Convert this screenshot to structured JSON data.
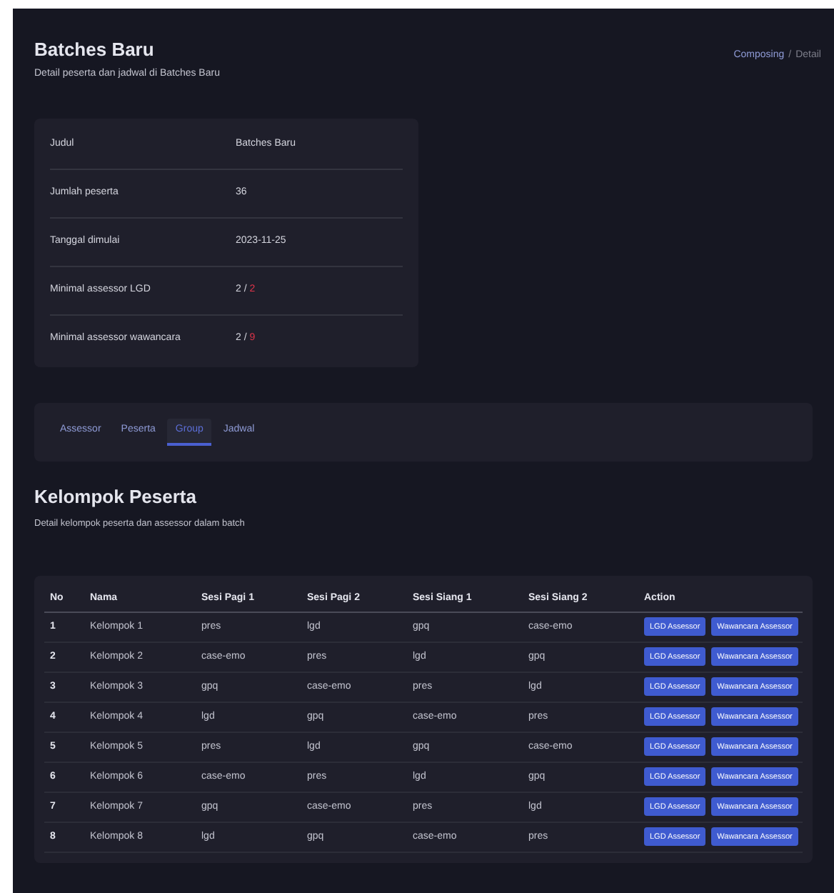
{
  "header": {
    "title": "Batches Baru",
    "subtitle": "Detail peserta dan jadwal di Batches Baru"
  },
  "breadcrumb": [
    {
      "label": "Composing",
      "link": true
    },
    {
      "label": "/",
      "link": false
    },
    {
      "label": "Detail",
      "link": false
    }
  ],
  "details": [
    {
      "kind": "text",
      "label": "Judul",
      "value": "Batches Baru"
    },
    {
      "kind": "text",
      "label": "Jumlah peserta",
      "value": "36"
    },
    {
      "kind": "text",
      "label": "Tanggal dimulai",
      "value": "2023-11-25"
    },
    {
      "kind": "ratio",
      "label": "Minimal assessor LGD",
      "value": "2",
      "separator": "/",
      "limit": "2"
    },
    {
      "kind": "ratio",
      "label": "Minimal assessor wawancara",
      "value": "2",
      "separator": "/",
      "limit": "9"
    }
  ],
  "tabs": [
    {
      "label": "Assessor",
      "selected": false
    },
    {
      "label": "Peserta",
      "selected": false
    },
    {
      "label": "Group",
      "selected": true
    },
    {
      "label": "Jadwal",
      "selected": false
    }
  ],
  "section": {
    "title": "Kelompok Peserta",
    "subtitle": "Detail kelompok peserta dan assessor dalam batch"
  },
  "table": {
    "columns": [
      "No",
      "Nama",
      "Sesi Pagi 1",
      "Sesi Pagi 2",
      "Sesi Siang 1",
      "Sesi Siang 2",
      "Action"
    ],
    "rows": [
      {
        "cells": [
          "1",
          "Kelompok 1",
          "pres",
          "lgd",
          "gpq",
          "case-emo"
        ],
        "actions": [
          "LGD Assessor",
          "Wawancara Assessor"
        ]
      },
      {
        "cells": [
          "2",
          "Kelompok 2",
          "case-emo",
          "pres",
          "lgd",
          "gpq"
        ],
        "actions": [
          "LGD Assessor",
          "Wawancara Assessor"
        ]
      },
      {
        "cells": [
          "3",
          "Kelompok 3",
          "gpq",
          "case-emo",
          "pres",
          "lgd"
        ],
        "actions": [
          "LGD Assessor",
          "Wawancara Assessor"
        ]
      },
      {
        "cells": [
          "4",
          "Kelompok 4",
          "lgd",
          "gpq",
          "case-emo",
          "pres"
        ],
        "actions": [
          "LGD Assessor",
          "Wawancara Assessor"
        ]
      },
      {
        "cells": [
          "5",
          "Kelompok 5",
          "pres",
          "lgd",
          "gpq",
          "case-emo"
        ],
        "actions": [
          "LGD Assessor",
          "Wawancara Assessor"
        ]
      },
      {
        "cells": [
          "6",
          "Kelompok 6",
          "case-emo",
          "pres",
          "lgd",
          "gpq"
        ],
        "actions": [
          "LGD Assessor",
          "Wawancara Assessor"
        ]
      },
      {
        "cells": [
          "7",
          "Kelompok 7",
          "gpq",
          "case-emo",
          "pres",
          "lgd"
        ],
        "actions": [
          "LGD Assessor",
          "Wawancara Assessor"
        ]
      },
      {
        "cells": [
          "8",
          "Kelompok 8",
          "lgd",
          "gpq",
          "case-emo",
          "pres"
        ],
        "actions": [
          "LGD Assessor",
          "Wawancara Assessor"
        ]
      }
    ]
  }
}
